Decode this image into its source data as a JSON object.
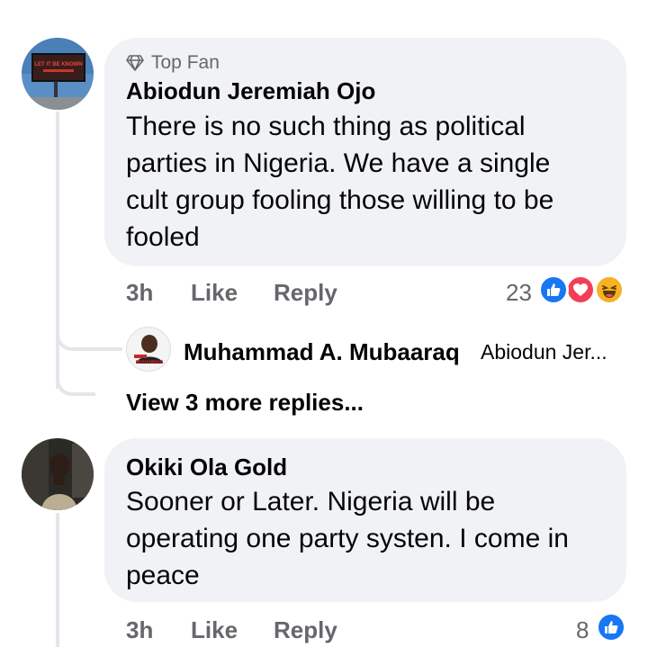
{
  "comments": [
    {
      "badge": "Top Fan",
      "author": "Abiodun Jeremiah Ojo",
      "text_lines": [
        "There is no such thing as political",
        "parties in Nigeria. We have a single",
        "cult group fooling those willing to be",
        "fooled"
      ],
      "time": "3h",
      "like_label": "Like",
      "reply_label": "Reply",
      "reaction_count": "23",
      "reactions": [
        "like-icon",
        "love-icon",
        "haha-icon"
      ],
      "reply_preview": {
        "author": "Muhammad A. Mubaaraq",
        "snippet": "Abiodun Jer...",
        "avatar_text": "MUHAMMAD"
      },
      "view_more": "View 3 more replies..."
    },
    {
      "author": "Okiki Ola Gold",
      "text_lines": [
        "Sooner or Later. Nigeria will be",
        "operating one party systen. I come in",
        "peace"
      ],
      "time": "3h",
      "like_label": "Like",
      "reply_label": "Reply",
      "reaction_count": "8",
      "reactions": [
        "like-icon"
      ]
    }
  ],
  "avatar1_billboard_text": "LET IT BE KNOWN",
  "colors": {
    "bubble": "#f0f2f5",
    "meta": "#65676b",
    "like_blue": "#1877f2",
    "love_red": "#f33e58",
    "haha_yellow": "#f7b125"
  }
}
